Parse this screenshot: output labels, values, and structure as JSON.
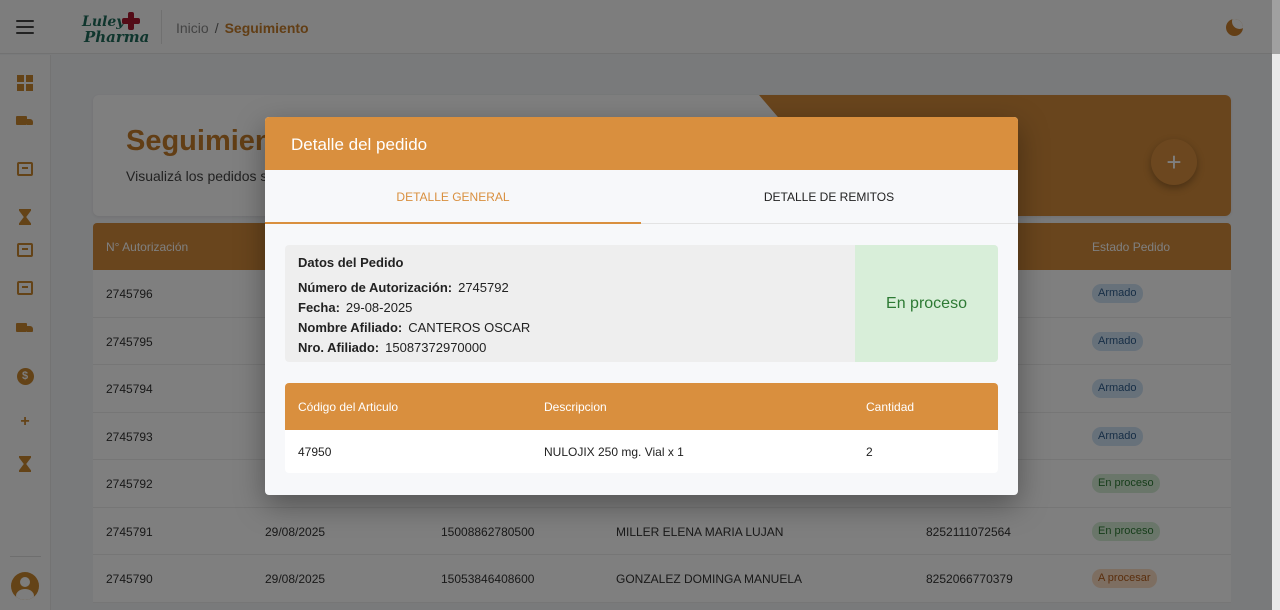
{
  "header": {
    "logo_line1": "Luley",
    "logo_line2": "Pharma",
    "breadcrumb_home": "Inicio",
    "breadcrumb_sep": "/",
    "breadcrumb_current": "Seguimiento"
  },
  "page": {
    "title": "Seguimiento de pedidos",
    "subtitle": "Visualizá los pedidos según su estado",
    "add_button": "+"
  },
  "table": {
    "headers": {
      "autorizacion": "N° Autorización",
      "estado": "Estado Pedido"
    },
    "rows": [
      {
        "autorizacion": "2745796",
        "fecha": "",
        "nro_afiliado": "",
        "afiliado": "",
        "codigo": "",
        "estado": "Armado",
        "estado_kind": "armado"
      },
      {
        "autorizacion": "2745795",
        "fecha": "",
        "nro_afiliado": "",
        "afiliado": "",
        "codigo": "",
        "estado": "Armado",
        "estado_kind": "armado"
      },
      {
        "autorizacion": "2745794",
        "fecha": "",
        "nro_afiliado": "",
        "afiliado": "",
        "codigo": "",
        "estado": "Armado",
        "estado_kind": "armado"
      },
      {
        "autorizacion": "2745793",
        "fecha": "",
        "nro_afiliado": "",
        "afiliado": "",
        "codigo": "",
        "estado": "Armado",
        "estado_kind": "armado"
      },
      {
        "autorizacion": "2745792",
        "fecha": "",
        "nro_afiliado": "",
        "afiliado": "",
        "codigo": "",
        "estado": "En proceso",
        "estado_kind": "proceso"
      },
      {
        "autorizacion": "2745791",
        "fecha": "29/08/2025",
        "nro_afiliado": "15008862780500",
        "afiliado": "MILLER ELENA MARIA LUJAN",
        "codigo": "8252111072564",
        "estado": "En proceso",
        "estado_kind": "proceso"
      },
      {
        "autorizacion": "2745790",
        "fecha": "29/08/2025",
        "nro_afiliado": "15053846408600",
        "afiliado": "GONZALEZ DOMINGA MANUELA",
        "codigo": "8252066770379",
        "estado": "A procesar",
        "estado_kind": "procesar"
      }
    ]
  },
  "modal": {
    "title": "Detalle del pedido",
    "tabs": [
      "Detalle General",
      "Detalle de Remitos"
    ],
    "info": {
      "section_title": "Datos del Pedido",
      "autorizacion_label": "Número de Autorización:",
      "autorizacion_value": "2745792",
      "fecha_label": "Fecha:",
      "fecha_value": "29-08-2025",
      "afiliado_label": "Nombre Afiliado:",
      "afiliado_value": "CANTEROS OSCAR",
      "nro_label": "Nro. Afiliado:",
      "nro_value": "15087372970000",
      "status": "En proceso"
    },
    "items": {
      "headers": [
        "Código del Articulo",
        "Descripcion",
        "Cantidad"
      ],
      "rows": [
        {
          "codigo": "47950",
          "descripcion": "NULOJIX 250 mg. Vial x 1",
          "cantidad": "2"
        }
      ]
    }
  },
  "colors": {
    "accent": "#d98f3e",
    "brand_green": "#1f6b5a",
    "brand_red": "#a8182e",
    "status_green_bg": "#d8eed9",
    "status_green_text": "#2d7a34"
  },
  "icons": [
    "menu-icon",
    "dashboard-icon",
    "truck-icon",
    "checklist-icon",
    "hourglass-icon",
    "archive-icon",
    "download-box-icon",
    "delivery-truck-icon",
    "dollar-icon",
    "plus-icon",
    "hourglass-icon",
    "theme-toggle-icon",
    "user-avatar-icon"
  ]
}
